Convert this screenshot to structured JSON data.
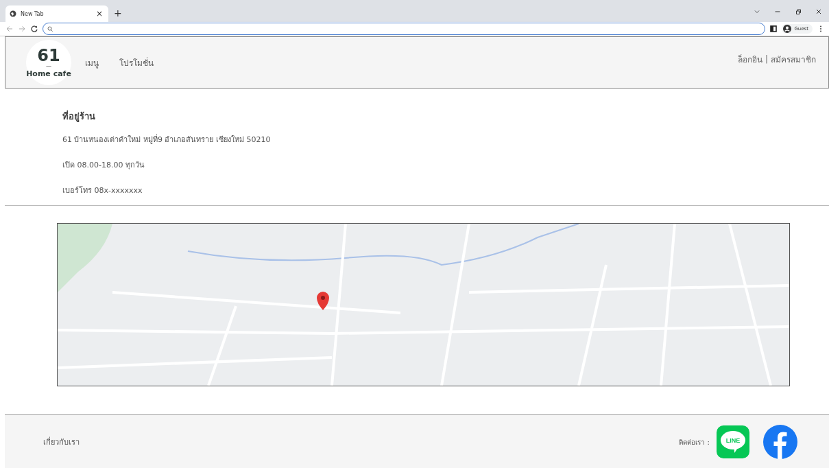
{
  "browser": {
    "tab": {
      "title": "New Tab",
      "close": "×"
    },
    "new_tab": "+",
    "profile": "Guest"
  },
  "header": {
    "logo": {
      "number": "61",
      "dash": "—",
      "name": "Home cafe"
    },
    "nav": [
      "เมนู",
      "โปรโมชั่น"
    ],
    "auth": {
      "login": "ล็อกอิน",
      "separator": "|",
      "register": "สมัครสมาชิก"
    }
  },
  "store_info": {
    "heading": "ที่อยู่ร้าน",
    "lines": [
      "61 บ้านหนองเต่าคำใหม่ หมู่ที่9 อำเภอสันทราย เชียงใหม่ 50210",
      "เปิด 08.00-18.00 ทุกวัน",
      "เบอร์โทร 08x-xxxxxxx"
    ]
  },
  "footer": {
    "about": "เกี่ยวกับเรา",
    "contact": "ติดต่อเรา :",
    "line_label": "LINE"
  }
}
